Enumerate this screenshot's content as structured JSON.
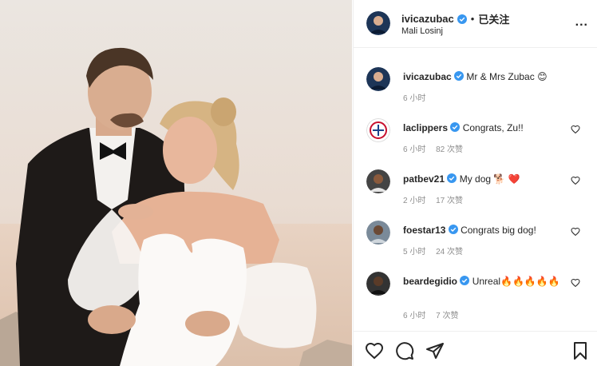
{
  "post": {
    "username": "ivicazubac",
    "dot": "•",
    "follow_label": "已关注",
    "location": "Mali Losinj",
    "more_label": "..."
  },
  "comments": [
    {
      "username": "ivicazubac",
      "text": "Mr & Mrs Zubac 😊",
      "time": "6 小时",
      "likes": "",
      "avatar_color": "#1d3557"
    },
    {
      "username": "laclippers",
      "text": "Congrats, Zu!!",
      "time": "6 小时",
      "likes": "82 次赞",
      "avatar_color": "#c8102e"
    },
    {
      "username": "patbev21",
      "text": "My dog 🐕 ❤️",
      "time": "2 小时",
      "likes": "17 次赞",
      "avatar_color": "#444444"
    },
    {
      "username": "foestar13",
      "text": "Congrats big dog!",
      "time": "5 小时",
      "likes": "24 次赞",
      "avatar_color": "#7a8a99"
    },
    {
      "username": "beardegidio",
      "text": "Unreal🔥🔥🔥🔥🔥",
      "time": "6 小时",
      "likes": "7 次赞",
      "avatar_color": "#333333"
    }
  ],
  "icons": {
    "verified": "verified-badge-icon",
    "heart": "heart-outline-icon",
    "comment": "comment-bubble-icon",
    "share": "paper-plane-icon",
    "save": "bookmark-icon"
  },
  "colors": {
    "verified_blue": "#3897f0",
    "text": "#262626",
    "muted": "#8e8e8e"
  }
}
